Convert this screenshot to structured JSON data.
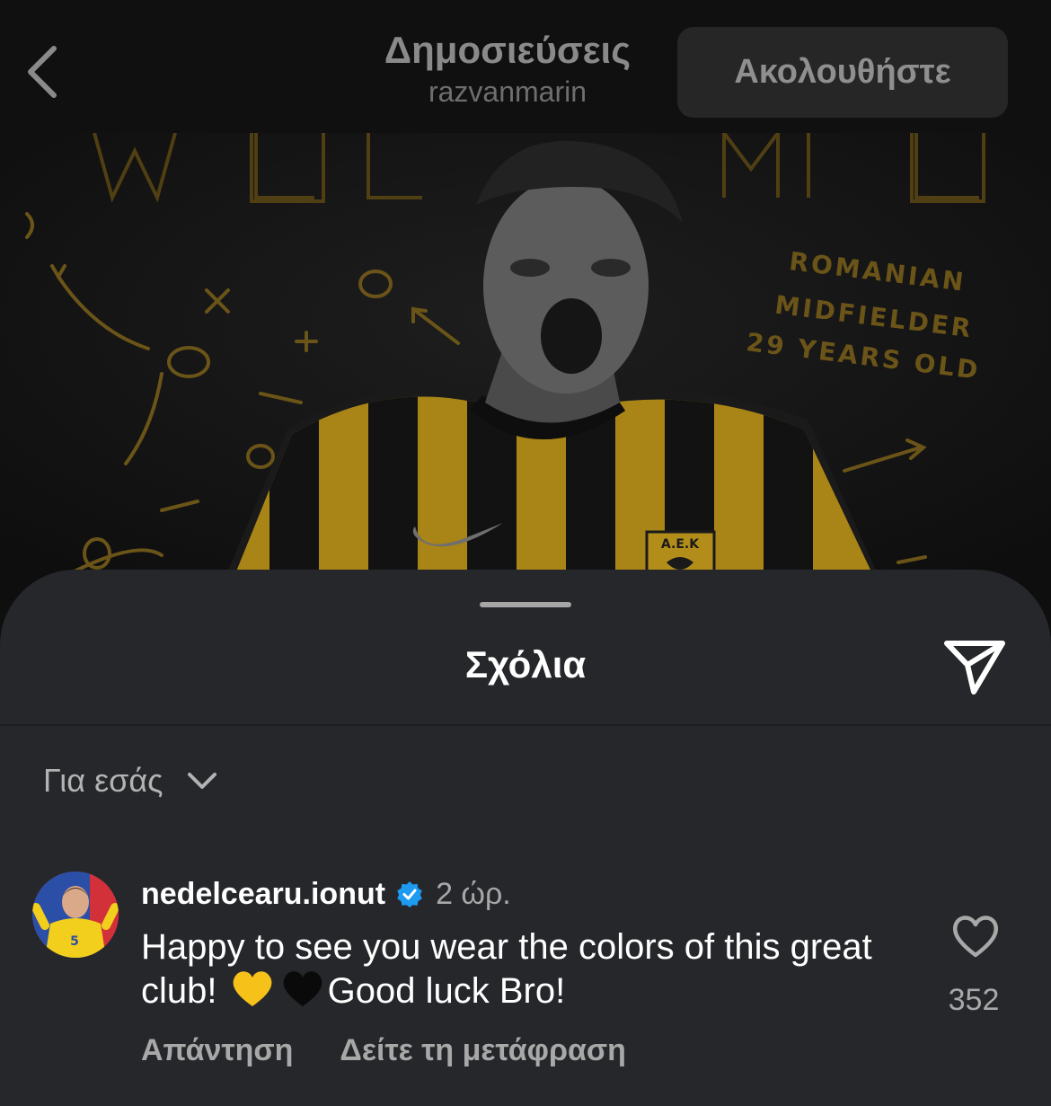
{
  "header": {
    "title": "Δημοσιεύσεις",
    "username": "razvanmarin",
    "follow_label": "Ακολουθήστε"
  },
  "post_image": {
    "overlay_text": [
      "ROMANIAN",
      "MIDFIELDER",
      "29 YEARS OLD"
    ],
    "crest_text": "A.E.K"
  },
  "comments_sheet": {
    "title": "Σχόλια",
    "sort_label": "Για εσάς",
    "comments": [
      {
        "username": "nedelcearu.ionut",
        "verified": true,
        "time": "2 ώρ.",
        "text_part1": "Happy to see you wear the colors of this great club!",
        "text_part2": "Good luck Bro!",
        "emojis": [
          "yellow-heart",
          "black-heart"
        ],
        "likes": "352",
        "reply_label": "Απάντηση",
        "translate_label": "Δείτε τη μετάφραση"
      }
    ]
  },
  "colors": {
    "sheet_bg": "#25272b",
    "verified_blue": "#1d9bf0",
    "jersey_yellow": "#c9a226"
  }
}
